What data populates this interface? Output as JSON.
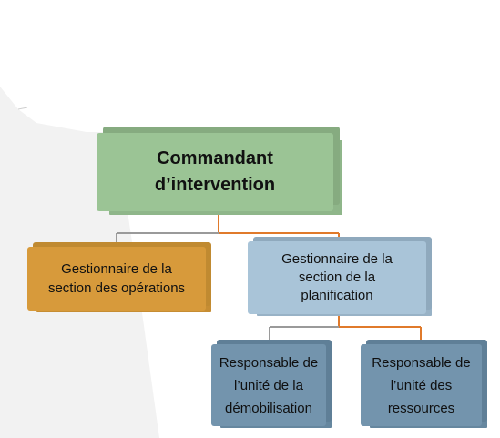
{
  "diagram": {
    "root": {
      "label": "Commandant\nd’intervention"
    },
    "children": [
      {
        "label": "Gestionnaire de la\nsection des opérations"
      },
      {
        "label": "Gestionnaire de la\nsection de la\nplanification"
      }
    ],
    "grandchildren": [
      {
        "label": "Responsable de\nl’unité de la\ndémobilisation"
      },
      {
        "label": "Responsable de\nl’unité des\nressources"
      }
    ]
  },
  "colors": {
    "root": "#9bc495",
    "operations": "#d79a3b",
    "planning": "#a9c4d8",
    "units": "#7394ad",
    "connector_gray": "#9a9a9a",
    "connector_orange": "#e07a2b"
  }
}
